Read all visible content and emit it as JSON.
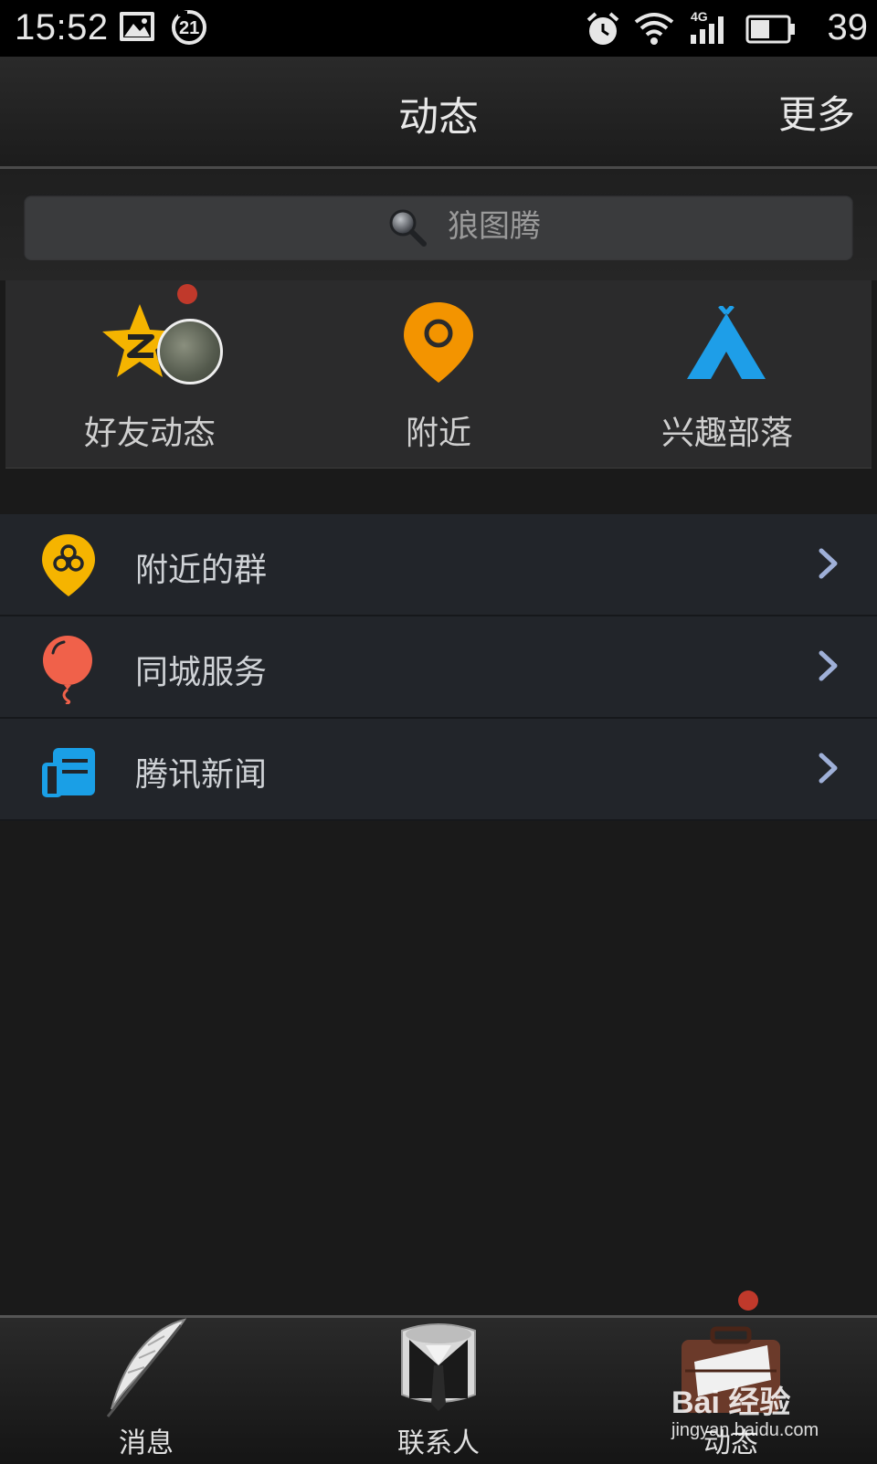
{
  "status_bar": {
    "time": "15:52",
    "network": "4G",
    "battery": "39",
    "badge_number": "21"
  },
  "header": {
    "title": "动态",
    "more_label": "更多"
  },
  "search": {
    "placeholder": "狼图腾"
  },
  "quick_actions": [
    {
      "label": "好友动态",
      "icon": "qzone-star-icon",
      "color": "#f5b400",
      "has_badge": true
    },
    {
      "label": "附近",
      "icon": "location-pin-icon",
      "color": "#f39400"
    },
    {
      "label": "兴趣部落",
      "icon": "tent-icon",
      "color": "#1e9ee8"
    }
  ],
  "list_items": [
    {
      "label": "附近的群",
      "icon": "nearby-group-icon",
      "color": "#f5b400"
    },
    {
      "label": "同城服务",
      "icon": "balloon-icon",
      "color": "#f0614a"
    },
    {
      "label": "腾讯新闻",
      "icon": "news-icon",
      "color": "#1a9fe6"
    }
  ],
  "tabs": [
    {
      "label": "消息",
      "icon": "feather-icon"
    },
    {
      "label": "联系人",
      "icon": "shirt-tie-icon"
    },
    {
      "label": "动态",
      "icon": "briefcase-icon",
      "active": true,
      "has_badge": true
    }
  ],
  "watermark": {
    "brand": "Bai 经验",
    "url": "jingyan.baidu.com"
  },
  "colors": {
    "badge": "#c0392b",
    "background": "#1a1a1a",
    "list_background": "#22252a",
    "chevron": "#9fb0d8"
  }
}
